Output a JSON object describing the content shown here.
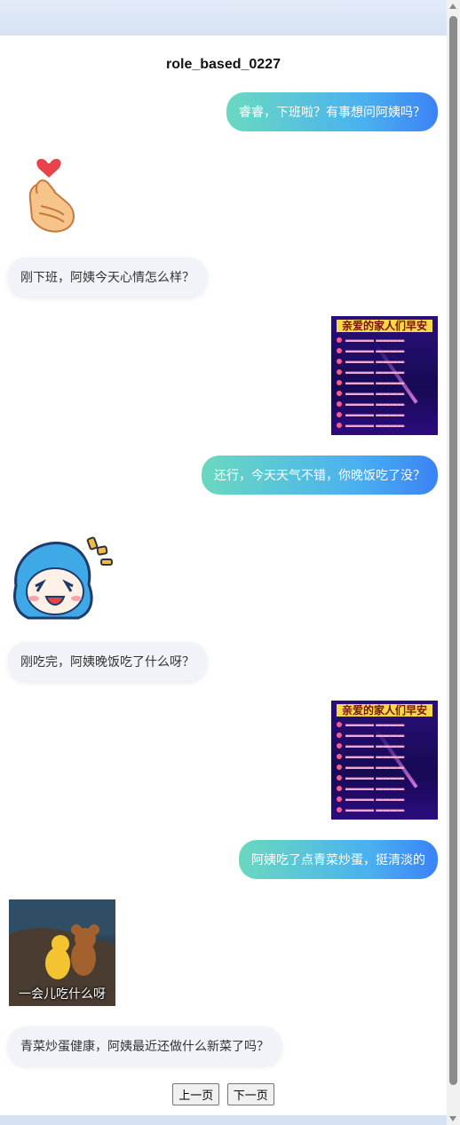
{
  "header": {
    "title": "role_based_0227"
  },
  "messages": {
    "m1": "睿睿，下班啦？有事想问阿姨吗？",
    "m2": "刚下班，阿姨今天心情怎么样？",
    "m3": "还行，今天天气不错，你晚饭吃了没？",
    "m4": "刚吃完，阿姨晚饭吃了什么呀？",
    "m5": "阿姨吃了点青菜炒蛋，挺清淡的",
    "m6": "青菜炒蛋健康，阿姨最近还做什么新菜了吗？"
  },
  "images": {
    "card_banner": "亲爱的家人们早安",
    "photo_caption": "一会儿吃什么呀",
    "heart_hand_icon": "finger-heart-icon",
    "anime_icon": "anime-girl-sticker"
  },
  "pager": {
    "prev_label": "上一页",
    "next_label": "下一页"
  },
  "colors": {
    "user_bubble_start": "#6ad9c0",
    "user_bubble_end": "#3b82f6",
    "bot_bubble": "#f1f3f8"
  }
}
